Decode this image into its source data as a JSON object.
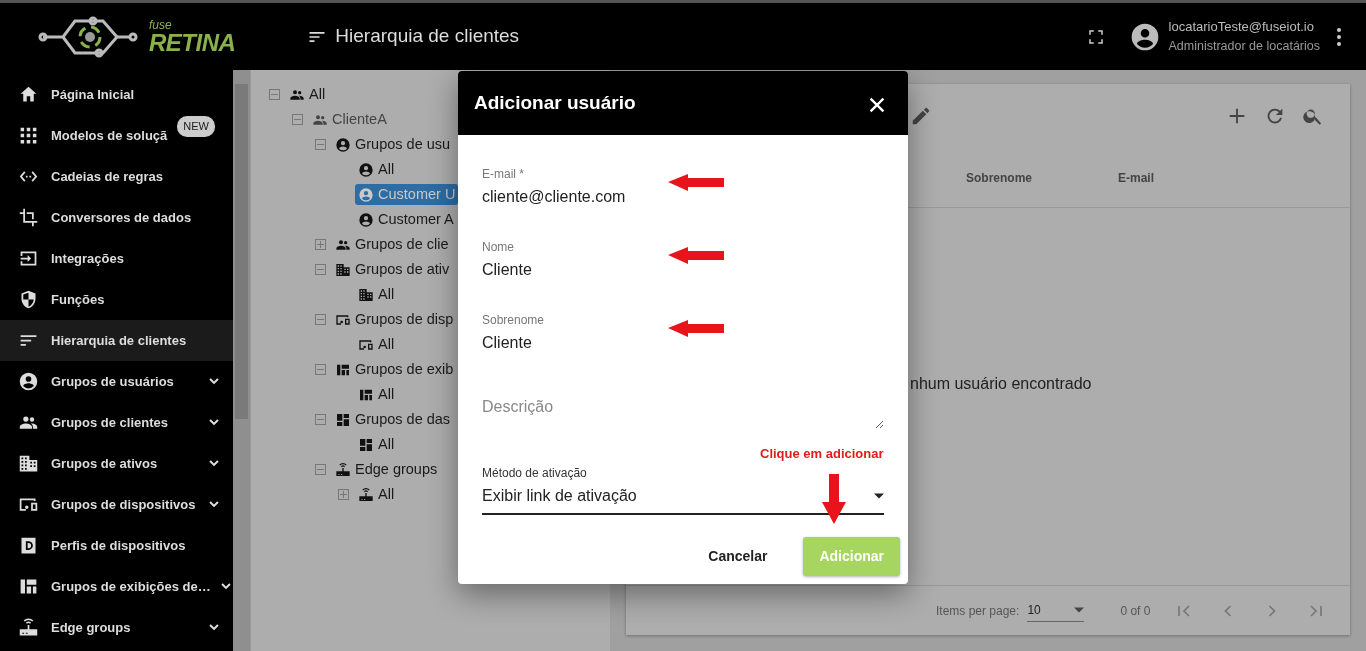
{
  "header": {
    "logo_small": "fuse",
    "logo": "RETINA",
    "title": "Hierarquia de clientes",
    "user_email": "locatarioTeste@fuseiot.io",
    "user_role": "Administrador de locatários"
  },
  "sidebar": {
    "items": [
      {
        "label": "Página Inicial",
        "selected": false,
        "expandable": false
      },
      {
        "label": "Modelos de soluçã",
        "selected": false,
        "expandable": false,
        "badge": "NEW"
      },
      {
        "label": "Cadeias de regras",
        "selected": false,
        "expandable": false
      },
      {
        "label": "Conversores de dados",
        "selected": false,
        "expandable": false
      },
      {
        "label": "Integrações",
        "selected": false,
        "expandable": false
      },
      {
        "label": "Funções",
        "selected": false,
        "expandable": false
      },
      {
        "label": "Hierarquia de clientes",
        "selected": true,
        "expandable": false
      },
      {
        "label": "Grupos de usuários",
        "selected": false,
        "expandable": true
      },
      {
        "label": "Grupos de clientes",
        "selected": false,
        "expandable": true
      },
      {
        "label": "Grupos de ativos",
        "selected": false,
        "expandable": true
      },
      {
        "label": "Grupos de dispositivos",
        "selected": false,
        "expandable": true
      },
      {
        "label": "Perfis de dispositivos",
        "selected": false,
        "expandable": false
      },
      {
        "label": "Grupos de exibições de…",
        "selected": false,
        "expandable": true
      },
      {
        "label": "Edge groups",
        "selected": false,
        "expandable": true
      }
    ]
  },
  "tree": [
    {
      "label": "All",
      "expanded": true,
      "selected": false,
      "children": [
        {
          "label": "ClienteA",
          "expanded": true,
          "selected": false,
          "faded": true,
          "children": [
            {
              "label": "Grupos de usu",
              "expanded": true,
              "selected": false,
              "children": [
                {
                  "label": "All",
                  "selected": false
                },
                {
                  "label": "Customer U",
                  "selected": true
                },
                {
                  "label": "Customer A",
                  "selected": false
                }
              ]
            },
            {
              "label": "Grupos de clie",
              "expanded": false,
              "selected": false
            },
            {
              "label": "Grupos de ativ",
              "expanded": true,
              "selected": false,
              "children": [
                {
                  "label": "All",
                  "selected": false
                }
              ]
            },
            {
              "label": "Grupos de disp",
              "expanded": true,
              "selected": false,
              "children": [
                {
                  "label": "All",
                  "selected": false
                }
              ]
            },
            {
              "label": "Grupos de exib",
              "expanded": true,
              "selected": false,
              "children": [
                {
                  "label": "All",
                  "selected": false
                }
              ]
            },
            {
              "label": "Grupos de das",
              "expanded": true,
              "selected": false,
              "children": [
                {
                  "label": "All",
                  "selected": false
                }
              ]
            },
            {
              "label": "Edge groups",
              "expanded": true,
              "selected": false,
              "children": [
                {
                  "label": "All",
                  "expanded": false,
                  "selected": false
                }
              ]
            }
          ]
        }
      ]
    }
  ],
  "table": {
    "columns": [
      "Sobrenome",
      "E-mail"
    ],
    "empty_message": "nhum usuário encontrado"
  },
  "paginator": {
    "label": "Items per page:",
    "page_size": "10",
    "range": "0 of 0"
  },
  "dialog": {
    "title": "Adicionar usuário",
    "fields": [
      {
        "kind": "input",
        "label": "E-mail *",
        "value": "cliente@cliente.com",
        "marked": true
      },
      {
        "kind": "input",
        "label": "Nome",
        "value": "Cliente",
        "marked": true
      },
      {
        "kind": "input",
        "label": "Sobrenome",
        "value": "Cliente",
        "marked": true
      },
      {
        "kind": "textarea",
        "placeholder": "Descrição",
        "marked": false
      },
      {
        "kind": "select",
        "label": "Método de ativação",
        "value": "Exibir link de ativação",
        "marked": false
      }
    ],
    "annotation": "Clique em adicionar",
    "buttons": [
      {
        "label": "Cancelar",
        "kind": "text"
      },
      {
        "label": "Adicionar",
        "kind": "primary"
      }
    ]
  }
}
